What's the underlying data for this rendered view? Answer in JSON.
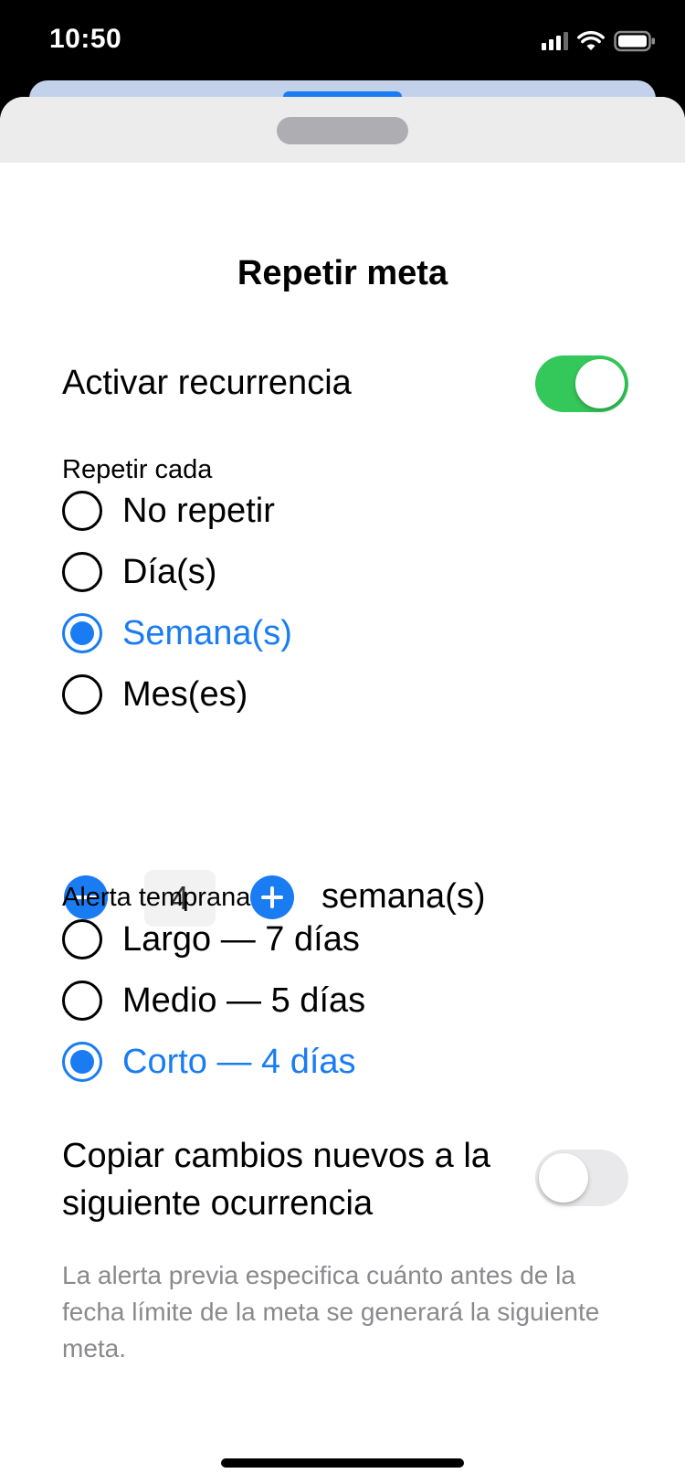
{
  "status_bar": {
    "time": "10:50",
    "icons": [
      "cellular-signal-icon",
      "wifi-icon",
      "battery-icon"
    ]
  },
  "sheet": {
    "title": "Repetir meta",
    "recurrence": {
      "label": "Activar recurrencia",
      "enabled": true
    },
    "repeat_every": {
      "section_label": "Repetir cada",
      "options": [
        {
          "label": "No repetir",
          "selected": false
        },
        {
          "label": "Día(s)",
          "selected": false
        },
        {
          "label": "Semana(s)",
          "selected": true
        },
        {
          "label": "Mes(es)",
          "selected": false
        }
      ]
    },
    "interval": {
      "value": "4",
      "unit": "semana(s)"
    },
    "early_alert": {
      "section_label": "Alerta temprana",
      "options": [
        {
          "label": "Largo — 7 días",
          "selected": false
        },
        {
          "label": "Medio — 5 días",
          "selected": false
        },
        {
          "label": "Corto — 4 días",
          "selected": true
        }
      ]
    },
    "copy_changes": {
      "label": "Copiar cambios nuevos a la siguiente ocurrencia",
      "enabled": false
    },
    "footnote": "La alerta previa especifica cuánto antes de la fecha límite de la meta se generará la siguiente meta."
  },
  "colors": {
    "accent": "#1a7cf2",
    "toggle_on": "#34c759",
    "toggle_off": "#e9e9eb",
    "secondary_text": "#8a8a8e"
  }
}
